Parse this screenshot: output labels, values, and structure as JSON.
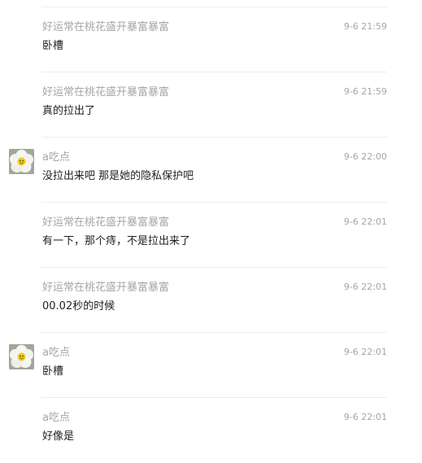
{
  "comments": [
    {
      "username": "好运常在桃花盛开暴富暴富",
      "time": "9-6 21:59",
      "text": "卧槽",
      "has_avatar": false
    },
    {
      "username": "好运常在桃花盛开暴富暴富",
      "time": "9-6 21:59",
      "text": "真的拉出了",
      "has_avatar": false
    },
    {
      "username": "a吃点",
      "time": "9-6 22:00",
      "text": "没拉出来吧 那是她的隐私保护吧",
      "has_avatar": true
    },
    {
      "username": "好运常在桃花盛开暴富暴富",
      "time": "9-6 22:01",
      "text": "有一下，那个痔，不是拉出来了",
      "has_avatar": false
    },
    {
      "username": "好运常在桃花盛开暴富暴富",
      "time": "9-6 22:01",
      "text": "00.02秒的时候",
      "has_avatar": false
    },
    {
      "username": "a吃点",
      "time": "9-6 22:01",
      "text": "卧槽",
      "has_avatar": true
    },
    {
      "username": "a吃点",
      "time": "9-6 22:01",
      "text": "好像是",
      "has_avatar": false
    }
  ],
  "colors": {
    "meta_text": "#a6a6a6",
    "body_text": "#222222",
    "divider": "#ececec"
  },
  "icons": {
    "avatar": "white-flower-avatar-icon"
  }
}
